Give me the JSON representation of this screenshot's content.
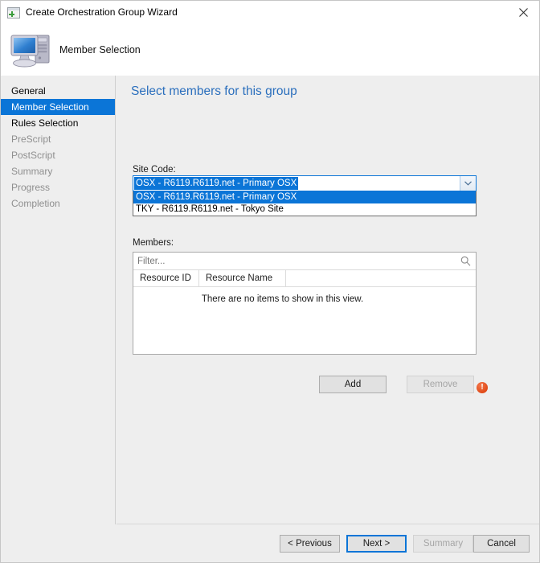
{
  "window": {
    "title": "Create Orchestration Group Wizard",
    "title_icon": "wizard-window-plus-icon",
    "close_label": "✕"
  },
  "banner": {
    "icon": "computer-icon",
    "title": "Member Selection"
  },
  "sidebar": {
    "items": [
      {
        "label": "General",
        "state": "enabled"
      },
      {
        "label": "Member Selection",
        "state": "selected"
      },
      {
        "label": "Rules Selection",
        "state": "enabled"
      },
      {
        "label": "PreScript",
        "state": "disabled"
      },
      {
        "label": "PostScript",
        "state": "disabled"
      },
      {
        "label": "Summary",
        "state": "disabled"
      },
      {
        "label": "Progress",
        "state": "disabled"
      },
      {
        "label": "Completion",
        "state": "disabled"
      }
    ]
  },
  "main": {
    "heading": "Select members for this group",
    "site_code": {
      "label": "Site Code:",
      "selected": "OSX - R6119.R6119.net  -  Primary OSX",
      "expanded": true,
      "options": [
        {
          "label": "OSX - R6119.R6119.net  -  Primary OSX",
          "highlighted": true
        },
        {
          "label": "TKY - R6119.R6119.net - Tokyo Site",
          "highlighted": false
        }
      ]
    },
    "members": {
      "label": "Members:",
      "filter_placeholder": "Filter...",
      "filter_value": "",
      "search_icon": "search-icon",
      "columns": [
        "Resource ID",
        "Resource Name"
      ],
      "rows": [],
      "empty_message": "There are no items to show in this view.",
      "error_icon": "error-exclamation-icon",
      "error_glyph": "!"
    },
    "actions": {
      "add_label": "Add",
      "remove_label": "Remove"
    }
  },
  "footer": {
    "previous_label": "< Previous",
    "next_label": "Next >",
    "summary_label": "Summary",
    "cancel_label": "Cancel"
  },
  "colors": {
    "accent": "#0b75d7",
    "heading": "#2b6fbd",
    "panel_bg": "#eeeeee",
    "error": "#e04a18"
  }
}
